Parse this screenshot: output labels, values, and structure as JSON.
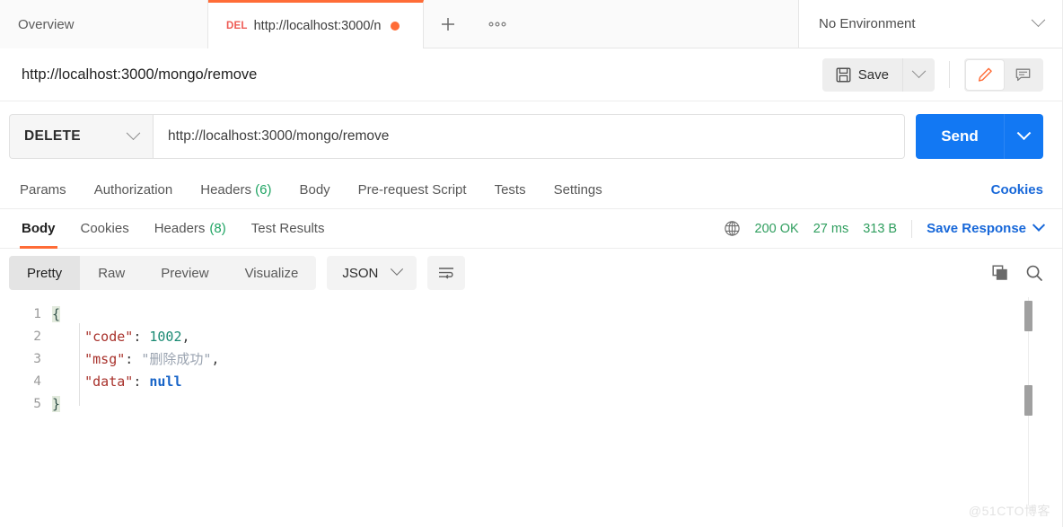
{
  "tabstrip": {
    "overview_label": "Overview",
    "request_tab": {
      "method": "DEL",
      "title": "http://localhost:3000/n",
      "unsaved": true
    },
    "new_tab_label": "+",
    "more_label": "ooo",
    "environment": {
      "selected": "No Environment"
    }
  },
  "title_row": {
    "request_name": "http://localhost:3000/mongo/remove",
    "save_label": "Save"
  },
  "url_row": {
    "method": "DELETE",
    "url": "http://localhost:3000/mongo/remove",
    "send_label": "Send"
  },
  "request_tabs": {
    "items": [
      {
        "label": "Params",
        "count": ""
      },
      {
        "label": "Authorization",
        "count": ""
      },
      {
        "label": "Headers",
        "count": "(6)"
      },
      {
        "label": "Body",
        "count": ""
      },
      {
        "label": "Pre-request Script",
        "count": ""
      },
      {
        "label": "Tests",
        "count": ""
      },
      {
        "label": "Settings",
        "count": ""
      }
    ],
    "cookies_label": "Cookies"
  },
  "response": {
    "tabs": [
      {
        "label": "Body",
        "count": ""
      },
      {
        "label": "Cookies",
        "count": ""
      },
      {
        "label": "Headers",
        "count": "(8)"
      },
      {
        "label": "Test Results",
        "count": ""
      }
    ],
    "active_tab": "Body",
    "status": "200 OK",
    "time": "27 ms",
    "size": "313 B",
    "save_response_label": "Save Response"
  },
  "format_bar": {
    "views": [
      "Pretty",
      "Raw",
      "Preview",
      "Visualize"
    ],
    "active_view": "Pretty",
    "language": "JSON"
  },
  "code": {
    "lines": [
      {
        "no": "1",
        "text": "{"
      },
      {
        "no": "2",
        "text": "    \"code\": 1002,"
      },
      {
        "no": "3",
        "text": "    \"msg\": \"删除成功\","
      },
      {
        "no": "4",
        "text": "    \"data\": null"
      },
      {
        "no": "5",
        "text": "}"
      }
    ],
    "json": {
      "code": "1002",
      "msg": "删除成功",
      "data": "null"
    }
  },
  "watermark": "@51CTO博客",
  "colors": {
    "accent_orange": "#ff6c37",
    "send_blue": "#1278f3",
    "link_blue": "#1868d9",
    "status_green": "#2f9e5e",
    "method_red": "#ee5b55"
  }
}
